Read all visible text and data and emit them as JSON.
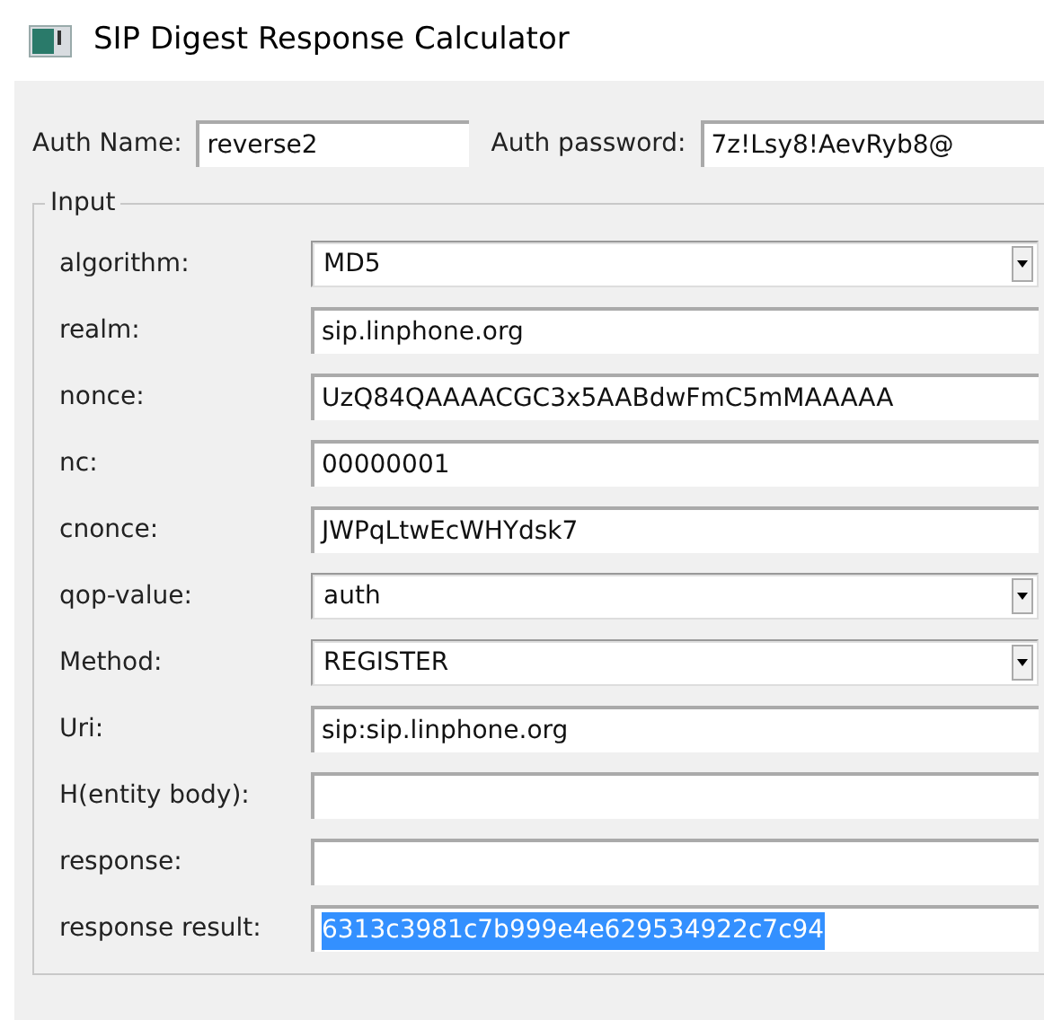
{
  "window": {
    "title": "SIP Digest Response Calculator"
  },
  "auth": {
    "name_label": "Auth Name:",
    "name_value": "reverse2",
    "password_label": "Auth password:",
    "password_value": "7z!Lsy8!AevRyb8@"
  },
  "input_group": {
    "title": "Input",
    "fields": [
      {
        "label": "algorithm:",
        "kind": "dropdown",
        "value": "MD5",
        "text_selected": false
      },
      {
        "label": "realm:",
        "kind": "text",
        "value": "sip.linphone.org",
        "text_selected": false
      },
      {
        "label": "nonce:",
        "kind": "text",
        "value": "UzQ84QAAAACGC3x5AABdwFmC5mMAAAAA",
        "text_selected": false
      },
      {
        "label": "nc:",
        "kind": "text",
        "value": "00000001",
        "text_selected": false
      },
      {
        "label": "cnonce:",
        "kind": "text",
        "value": "JWPqLtwEcWHYdsk7",
        "text_selected": false
      },
      {
        "label": "qop-value:",
        "kind": "dropdown",
        "value": "auth",
        "text_selected": false
      },
      {
        "label": "Method:",
        "kind": "dropdown",
        "value": "REGISTER",
        "text_selected": false
      },
      {
        "label": "Uri:",
        "kind": "text",
        "value": "sip:sip.linphone.org",
        "text_selected": false
      },
      {
        "label": "H(entity body):",
        "kind": "text",
        "text_selected": false
      },
      {
        "label": "response:",
        "kind": "text",
        "text_selected": false
      },
      {
        "label": "response result:",
        "kind": "text",
        "value": "6313c3981c7b999e4e629534922c7c94",
        "text_selected": true
      }
    ]
  }
}
